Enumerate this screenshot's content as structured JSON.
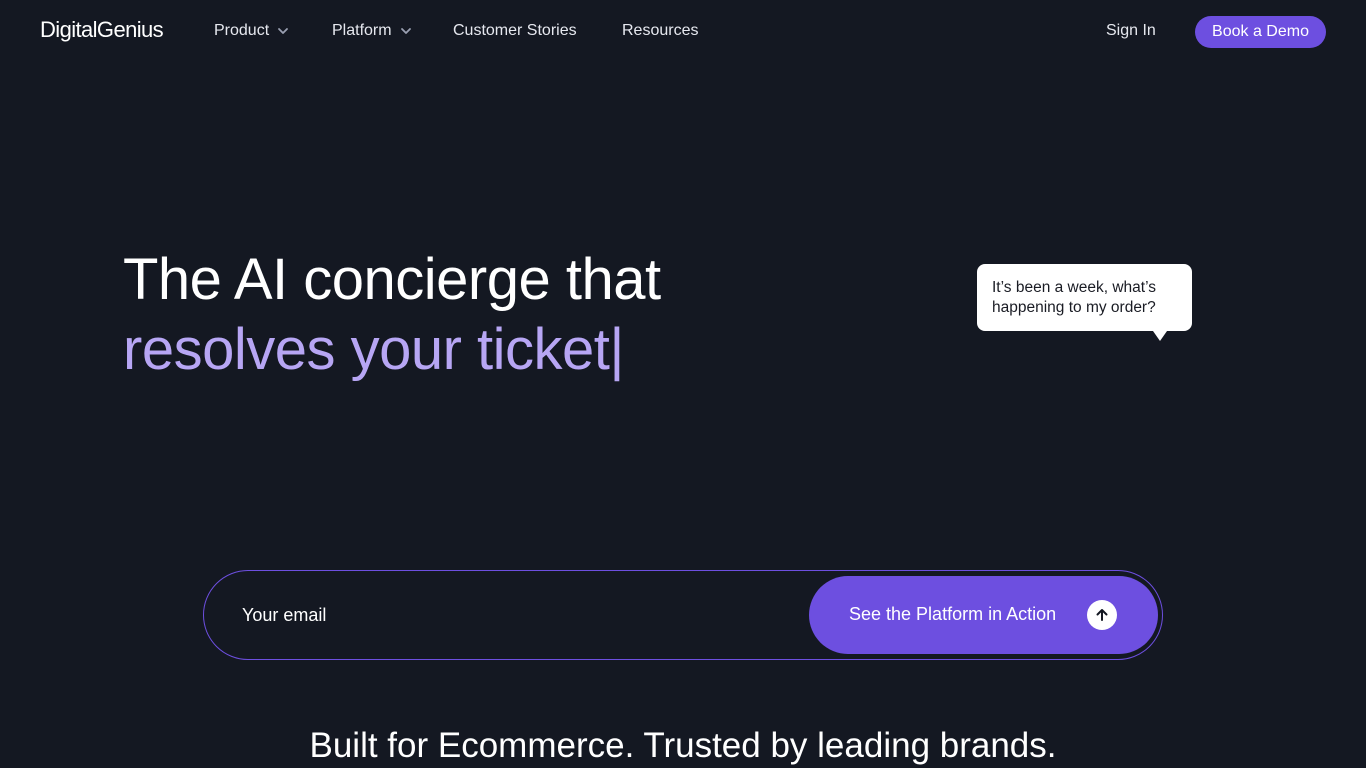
{
  "header": {
    "logo_text": "DigitalGenius",
    "nav": [
      {
        "label": "Product",
        "has_dropdown": true
      },
      {
        "label": "Platform",
        "has_dropdown": true
      },
      {
        "label": "Customer Stories",
        "has_dropdown": false
      },
      {
        "label": "Resources",
        "has_dropdown": false
      }
    ],
    "sign_in_label": "Sign In",
    "cta_label": "Book a Demo"
  },
  "hero": {
    "line1": "The AI concierge that",
    "line2": "resolves your ticket|"
  },
  "chat_bubble": {
    "text": "It’s been a week, what’s happening to my order?"
  },
  "email_form": {
    "placeholder": "Your email",
    "value": "",
    "button_label": "See the Platform in Action",
    "button_icon": "arrow-up-icon"
  },
  "trusted_heading": "Built for Ecommerce. Trusted by leading brands.",
  "colors": {
    "background": "#141822",
    "accent": "#6d4fe0",
    "highlight_text": "#b7a6f4",
    "bubble_bg": "#ffffff"
  }
}
